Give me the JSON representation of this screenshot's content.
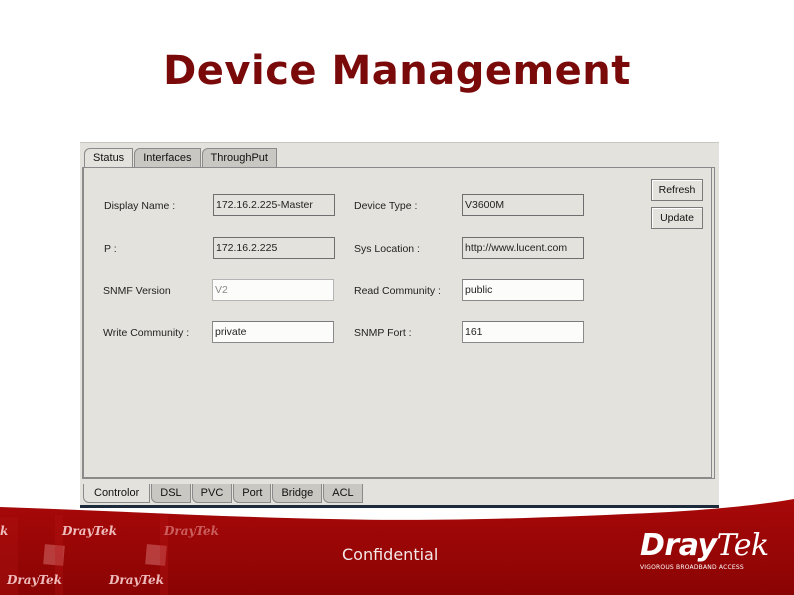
{
  "slide": {
    "title": "Device Management",
    "footer_text": "Confidential",
    "brand": {
      "name_part1": "Dray",
      "name_part2": "Tek",
      "tagline": "VIGOROUS BROADBAND ACCESS"
    },
    "watermark": "DrayTek",
    "colors": {
      "title": "#7a0a0a",
      "footer_red": "#9a0606"
    }
  },
  "app": {
    "top_tabs": [
      {
        "label": "Status",
        "active": true
      },
      {
        "label": "Interfaces",
        "active": false
      },
      {
        "label": "ThroughPut",
        "active": false
      }
    ],
    "fields": {
      "display_name": {
        "label": "Display Name :",
        "value": "172.16.2.225-Master"
      },
      "ip": {
        "label": "P :",
        "value": "172.16.2.225"
      },
      "snmp_version": {
        "label": "SNMF Version",
        "value": "V2"
      },
      "write_community": {
        "label": "Write Community :",
        "value": "private"
      },
      "device_type": {
        "label": "Device Type :",
        "value": "V3600M"
      },
      "sys_location": {
        "label": "Sys Location :",
        "value": "http://www.lucent.com"
      },
      "read_community": {
        "label": "Read Community :",
        "value": "public"
      },
      "snmp_port": {
        "label": "SNMP Fort :",
        "value": "161"
      }
    },
    "buttons": {
      "refresh": "Refresh",
      "update": "Update"
    },
    "bottom_tabs": [
      {
        "label": "Controlor",
        "active": true
      },
      {
        "label": "DSL",
        "active": false
      },
      {
        "label": "PVC",
        "active": false
      },
      {
        "label": "Port",
        "active": false
      },
      {
        "label": "Bridge",
        "active": false
      },
      {
        "label": "ACL",
        "active": false
      }
    ]
  }
}
